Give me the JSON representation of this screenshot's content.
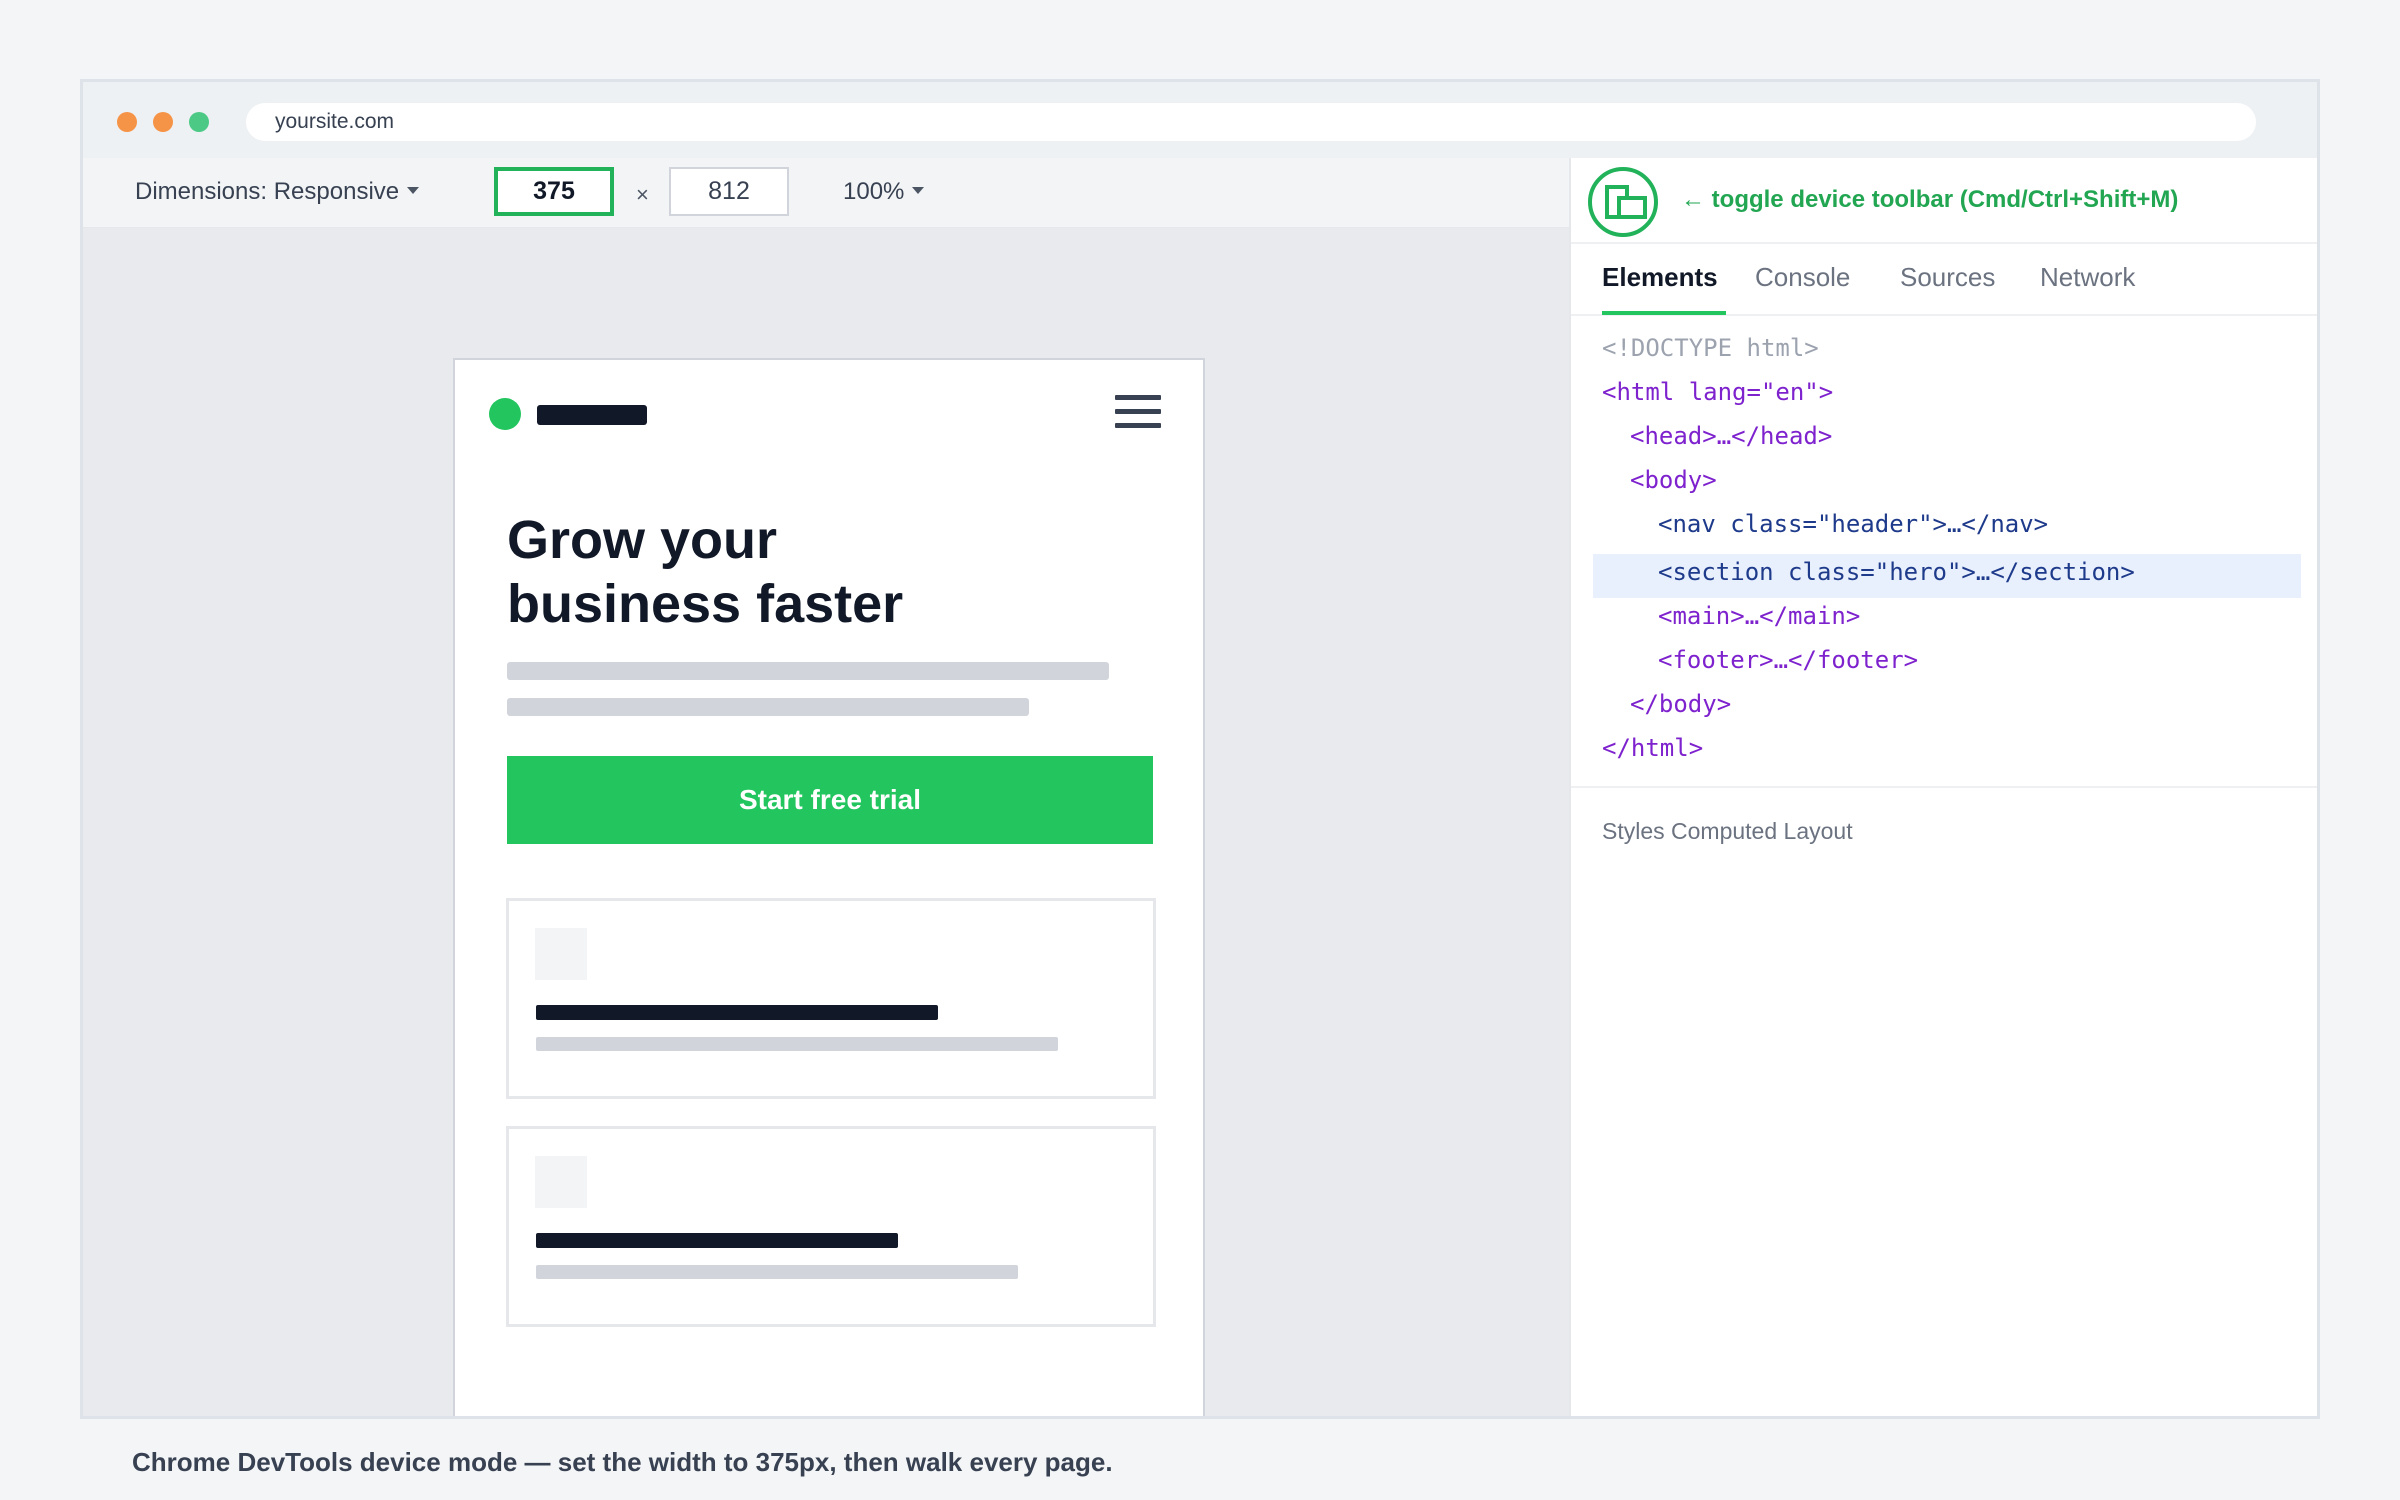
{
  "browser": {
    "url": "yoursite.com"
  },
  "device_toolbar": {
    "dimensions_label": "Dimensions: Responsive",
    "width": "375",
    "times": "×",
    "height": "812",
    "zoom": "100%"
  },
  "phone_page": {
    "hero_title_line1": "Grow your",
    "hero_title_line2": "business faster",
    "cta_label": "Start free trial"
  },
  "devtools": {
    "toggle_label": "← toggle device toolbar (Cmd/Ctrl+Shift+M)",
    "tabs": [
      "Elements",
      "Console",
      "Sources",
      "Network"
    ],
    "active_tab": "Elements",
    "dom_lines": [
      "<!DOCTYPE html>",
      "<html lang=\"en\">",
      "<head>…</head>",
      "<body>",
      "<nav class=\"header\">…</nav>",
      "<section class=\"hero\">…</section>",
      "<main>…</main>",
      "<footer>…</footer>",
      "</body>",
      "</html>"
    ],
    "selected_node": "<section class=\"hero\">…</section>",
    "styles_tabs": "Styles Computed Layout"
  },
  "caption": "Chrome DevTools device mode — set the width to 375px, then walk every page.",
  "colors": {
    "accent_green": "#22c55e",
    "highlight_green": "#22b35a",
    "tag_purple": "#7e22ce",
    "tag_navy": "#1e3a8a",
    "dot_orange": "#f59346",
    "dot_green": "#4cc985"
  }
}
